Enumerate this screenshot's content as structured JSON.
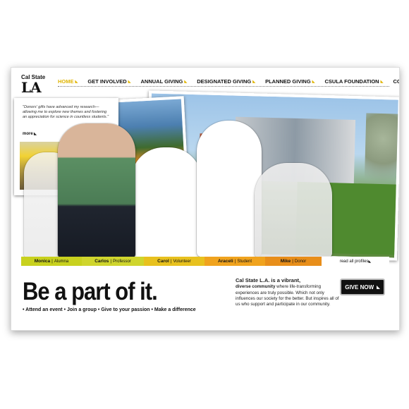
{
  "logo": {
    "line1": "Cal State",
    "line2": "LA"
  },
  "nav": {
    "items": [
      "HOME",
      "GET INVOLVED",
      "ANNUAL GIVING",
      "DESIGNATED GIVING",
      "PLANNED GIVING",
      "CSULA FOUNDATION",
      "CONTACT US"
    ]
  },
  "quote": {
    "text": "\"Donors' gifts have advanced my research—allowing me to explore new themes and fostering an appreciation for science in countless students.\"",
    "more": "more"
  },
  "profiles": [
    {
      "name": "Monica",
      "role": "Alumna"
    },
    {
      "name": "Carlos",
      "role": "Professor"
    },
    {
      "name": "Carol",
      "role": "Volunteer"
    },
    {
      "name": "Araceli",
      "role": "Student"
    },
    {
      "name": "Mike",
      "role": "Donor"
    }
  ],
  "read_all": "read all profiles",
  "headline": "Be a part of it.",
  "bullets": "• Attend an event • Join a group • Give to your passion • Make a difference",
  "blurb": {
    "lead": "Cal State L.A. is a vibrant,",
    "lead2": "diverse community",
    "body": " where life-transforming experiences are truly possible. Which not only influences our society for the better. But inspires all of us who support and participate in our community."
  },
  "give_button": "GIVE NOW",
  "colors": {
    "accent": "#e0b400",
    "button": "#111111"
  }
}
